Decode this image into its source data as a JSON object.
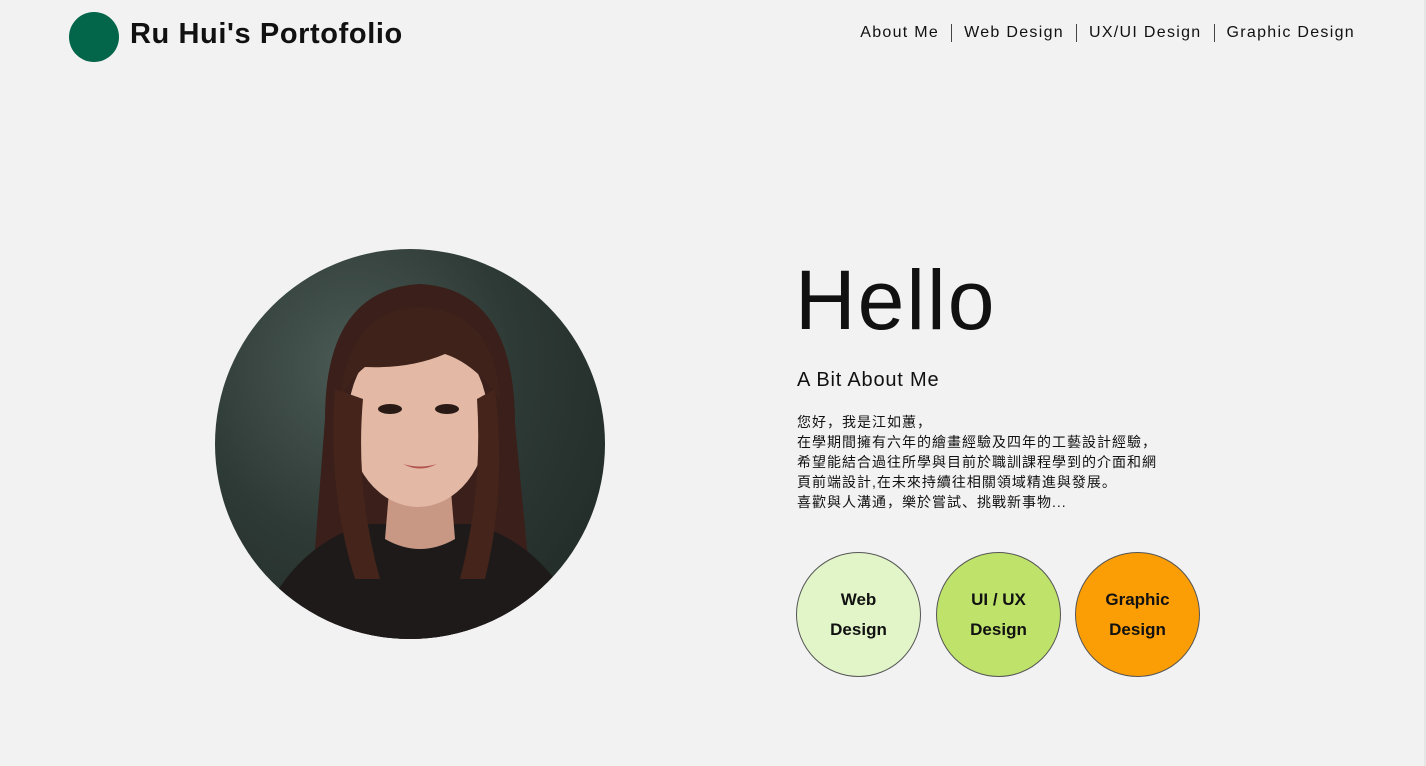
{
  "header": {
    "title": "Ru Hui's Portofolio",
    "logo_color": "#03654a"
  },
  "nav": {
    "items": [
      {
        "label": "About Me"
      },
      {
        "label": "Web Design"
      },
      {
        "label": "UX/UI Design"
      },
      {
        "label": "Graphic Design"
      }
    ]
  },
  "hero": {
    "greeting": "Hello",
    "about_heading": "A Bit About Me",
    "bio_lines": [
      "您好，我是江如蕙，",
      "在學期間擁有六年的繪畫經驗及四年的工藝設計經驗，",
      "希望能結合過往所學與目前於職訓課程學到的介面和網",
      "頁前端設計,在未來持續往相關領域精進與發展。",
      "喜歡與人溝通，樂於嘗試、挑戰新事物..."
    ]
  },
  "skills": [
    {
      "line1": "Web",
      "line2": "Design",
      "color": "#e1f5c8"
    },
    {
      "line1": "UI / UX",
      "line2": "Design",
      "color": "#bee26a"
    },
    {
      "line1": "Graphic",
      "line2": "Design",
      "color": "#fb9e05"
    }
  ]
}
